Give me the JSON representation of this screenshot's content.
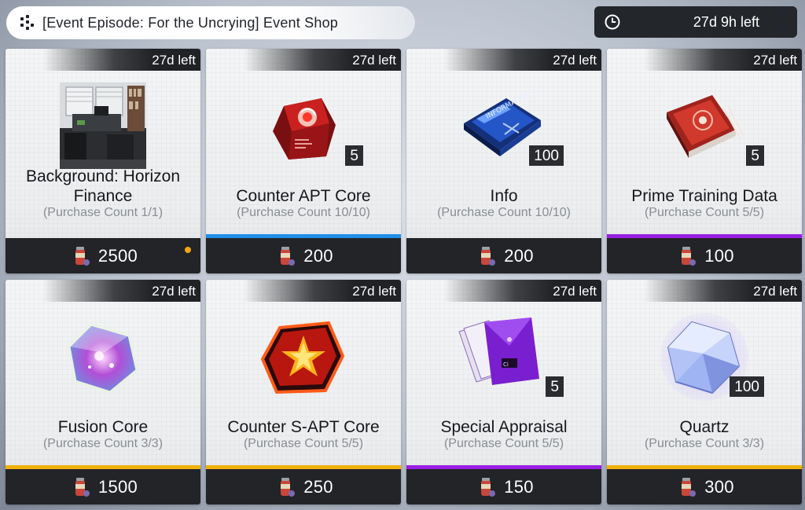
{
  "header": {
    "title": "[Event Episode: For the Uncrying] Event Shop",
    "timer": "27d 9h left"
  },
  "colors": {
    "blue": "#1f8fe8",
    "purple": "#9b1fe3",
    "yellow": "#f2b20c"
  },
  "items": [
    {
      "time_left": "27d left",
      "name": "Background: Horizon Finance",
      "purchase": "(Purchase Count 1/1)",
      "price": "2500",
      "qty": "",
      "rarity": "none",
      "icon": "office-background-image",
      "new": true
    },
    {
      "time_left": "27d left",
      "name": "Counter APT Core",
      "purchase": "(Purchase Count 10/10)",
      "price": "200",
      "qty": "5",
      "rarity": "blue",
      "icon": "red-cube-core-icon",
      "new": false
    },
    {
      "time_left": "27d left",
      "name": "Info",
      "purchase": "(Purchase Count 10/10)",
      "price": "200",
      "qty": "100",
      "rarity": "none",
      "icon": "blue-info-book-icon",
      "new": false
    },
    {
      "time_left": "27d left",
      "name": "Prime Training Data",
      "purchase": "(Purchase Count 5/5)",
      "price": "100",
      "qty": "5",
      "rarity": "purple",
      "icon": "red-training-book-icon",
      "new": false
    },
    {
      "time_left": "27d left",
      "name": "Fusion Core",
      "purchase": "(Purchase Count 3/3)",
      "price": "1500",
      "qty": "",
      "rarity": "yellow",
      "icon": "rainbow-crystal-icon",
      "new": false
    },
    {
      "time_left": "27d left",
      "name": "Counter S-APT Core",
      "purchase": "(Purchase Count 5/5)",
      "price": "250",
      "qty": "",
      "rarity": "yellow",
      "icon": "red-star-core-icon",
      "new": false
    },
    {
      "time_left": "27d left",
      "name": "Special Appraisal",
      "purchase": "(Purchase Count 5/5)",
      "price": "150",
      "qty": "5",
      "rarity": "purple",
      "icon": "purple-envelope-icon",
      "new": false
    },
    {
      "time_left": "27d left",
      "name": "Quartz",
      "purchase": "(Purchase Count 3/3)",
      "price": "300",
      "qty": "100",
      "rarity": "yellow",
      "icon": "blue-quartz-crystal-icon",
      "new": false
    }
  ]
}
